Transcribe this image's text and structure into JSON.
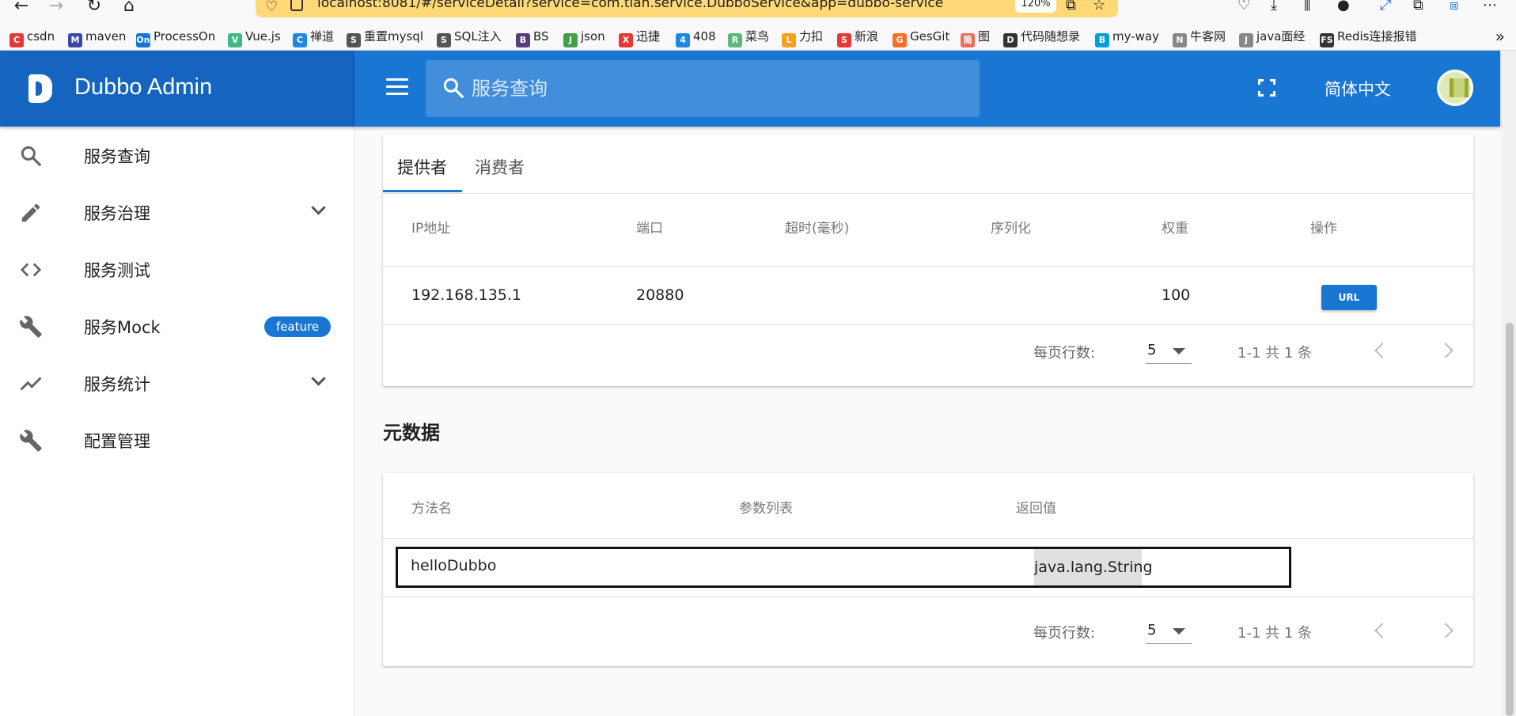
{
  "browser": {
    "url": "localhost:8081/#/serviceDetail?service=com.tian.service.DubboService&app=dubbo-service",
    "zoom": "120%",
    "bookmarks": [
      {
        "label": "csdn",
        "icon": "C",
        "color": "#e53935"
      },
      {
        "label": "maven",
        "icon": "M",
        "color": "#3949ab"
      },
      {
        "label": "ProcessOn",
        "icon": "On",
        "color": "#1976d2"
      },
      {
        "label": "Vue.js",
        "icon": "V",
        "color": "#41b883"
      },
      {
        "label": "禅道",
        "icon": "C",
        "color": "#1e88e5"
      },
      {
        "label": "重置mysql",
        "icon": "S",
        "color": "#555"
      },
      {
        "label": "SQL注入",
        "icon": "S",
        "color": "#555"
      },
      {
        "label": "BS",
        "icon": "B",
        "color": "#563d7c"
      },
      {
        "label": "json",
        "icon": "J",
        "color": "#43a047"
      },
      {
        "label": "迅捷",
        "icon": "X",
        "color": "#e53935"
      },
      {
        "label": "408",
        "icon": "4",
        "color": "#1e88e5"
      },
      {
        "label": "菜鸟",
        "icon": "R",
        "color": "#5fb878"
      },
      {
        "label": "力扣",
        "icon": "L",
        "color": "#f89f1b"
      },
      {
        "label": "新浪",
        "icon": "S",
        "color": "#e53935"
      },
      {
        "label": "GesGit",
        "icon": "G",
        "color": "#fc6d26"
      },
      {
        "label": "图",
        "icon": "简",
        "color": "#ea6f5a"
      },
      {
        "label": "代码随想录",
        "icon": "D",
        "color": "#333"
      },
      {
        "label": "my-way",
        "icon": "B",
        "color": "#00a1d6"
      },
      {
        "label": "牛客网",
        "icon": "N",
        "color": "#888"
      },
      {
        "label": "java面经",
        "icon": "J",
        "color": "#888"
      },
      {
        "label": "Redis连接报错",
        "icon": "FS",
        "color": "#333"
      }
    ]
  },
  "app": {
    "title": "Dubbo Admin",
    "search_placeholder": "服务查询",
    "language": "简体中文"
  },
  "sidebar": {
    "items": [
      {
        "label": "服务查询",
        "icon": "search-icon",
        "has_children": false
      },
      {
        "label": "服务治理",
        "icon": "pencil-icon",
        "has_children": true
      },
      {
        "label": "服务测试",
        "icon": "code-icon",
        "has_children": false
      },
      {
        "label": "服务Mock",
        "icon": "wrench-icon",
        "has_children": false,
        "badge": "feature"
      },
      {
        "label": "服务统计",
        "icon": "trending-icon",
        "has_children": true
      },
      {
        "label": "配置管理",
        "icon": "wrench-icon",
        "has_children": false
      }
    ]
  },
  "providers": {
    "tabs": [
      "提供者",
      "消费者"
    ],
    "active_tab": 0,
    "columns": [
      "IP地址",
      "端口",
      "超时(毫秒)",
      "序列化",
      "权重",
      "操作"
    ],
    "rows": [
      {
        "ip": "192.168.135.1",
        "port": "20880",
        "timeout": "",
        "serialization": "",
        "weight": "100",
        "action": "URL"
      }
    ],
    "pager": {
      "label": "每页行数:",
      "per_page": "5",
      "count": "1-1 共 1 条"
    }
  },
  "metadata": {
    "title": "元数据",
    "columns": [
      "方法名",
      "参数列表",
      "返回值"
    ],
    "rows": [
      {
        "method": "helloDubbo",
        "params": "",
        "return_type": "java.lang.String"
      }
    ],
    "pager": {
      "label": "每页行数:",
      "per_page": "5",
      "count": "1-1 共 1 条"
    }
  },
  "colors": {
    "primary": "#1976d2",
    "primary_dark": "#1565c0",
    "url_bar": "#ffd877"
  }
}
